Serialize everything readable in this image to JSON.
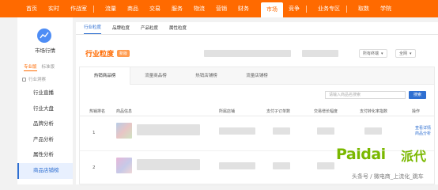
{
  "topnav": {
    "items": [
      "首页",
      "实时",
      "作战室",
      "流量",
      "商品",
      "交易",
      "服务",
      "物流",
      "营销",
      "财务",
      "市场",
      "竞争",
      "业务专区",
      "取数",
      "学院"
    ],
    "active": "市场"
  },
  "sidebar": {
    "title": "市场行情",
    "tabs": [
      "专业版",
      "标准版"
    ],
    "group_label": "行业洞察",
    "items": [
      "行业直播",
      "行业大盘",
      "品牌分析",
      "产品分析",
      "属性分析",
      "商品店铺榜"
    ],
    "active_item": "商品店铺榜"
  },
  "subtabs": [
    "行业粒度",
    "品牌粒度",
    "产品粒度",
    "属性粒度"
  ],
  "headline": {
    "title": "行业粒度",
    "badge": "新版"
  },
  "filters": {
    "terminal": "所有终端",
    "period": "全网"
  },
  "panel": {
    "tabs": [
      "热销商品榜",
      "流量商品榜",
      "热销店铺榜",
      "流量店铺榜"
    ],
    "search_placeholder": "请输入商品名搜索",
    "search_button": "搜索",
    "columns": [
      "热销排名",
      "商品信息",
      "所属店铺",
      "支付子订单数",
      "交易增长幅度",
      "支付转化率指数",
      "操作"
    ],
    "rows": [
      {
        "rank": "1",
        "ops": [
          "查看详情",
          "商品分析"
        ]
      },
      {
        "rank": "2",
        "ops": []
      }
    ]
  },
  "watermark": {
    "logo": "Paidai",
    "logo_cn": "派代",
    "caption": "头条号 / 微电商_上流化_跳车"
  }
}
